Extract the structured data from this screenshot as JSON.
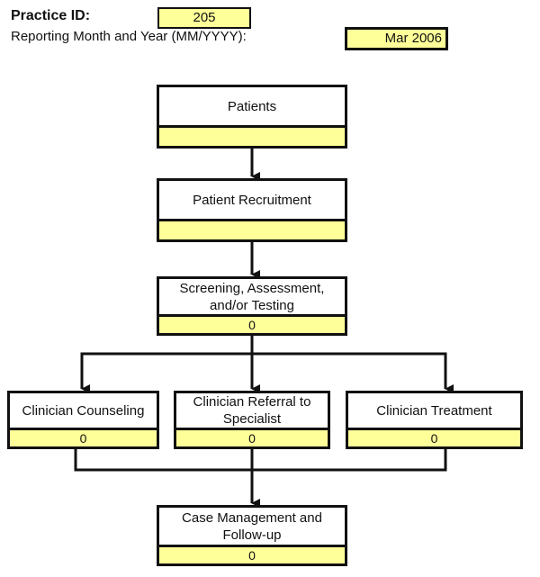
{
  "header": {
    "practice_id_label": "Practice ID:",
    "practice_id_value": "205",
    "reporting_label": "Reporting Month and Year (MM/YYYY):",
    "reporting_value": "Mar 2006"
  },
  "colors": {
    "field_fill": "#ffff99",
    "stroke": "#111111"
  },
  "flow": {
    "patients": {
      "title": "Patients",
      "value": ""
    },
    "recruitment": {
      "title": "Patient Recruitment",
      "value": ""
    },
    "screening": {
      "title": "Screening,  Assessment, and/or Testing",
      "value": "0"
    },
    "counseling": {
      "title": "Clinician Counseling",
      "value": "0"
    },
    "referral": {
      "title": "Clinician Referral to Specialist",
      "value": "0"
    },
    "treatment": {
      "title": "Clinician Treatment",
      "value": "0"
    },
    "case_management": {
      "title": "Case Management and Follow-up",
      "value": "0"
    }
  }
}
